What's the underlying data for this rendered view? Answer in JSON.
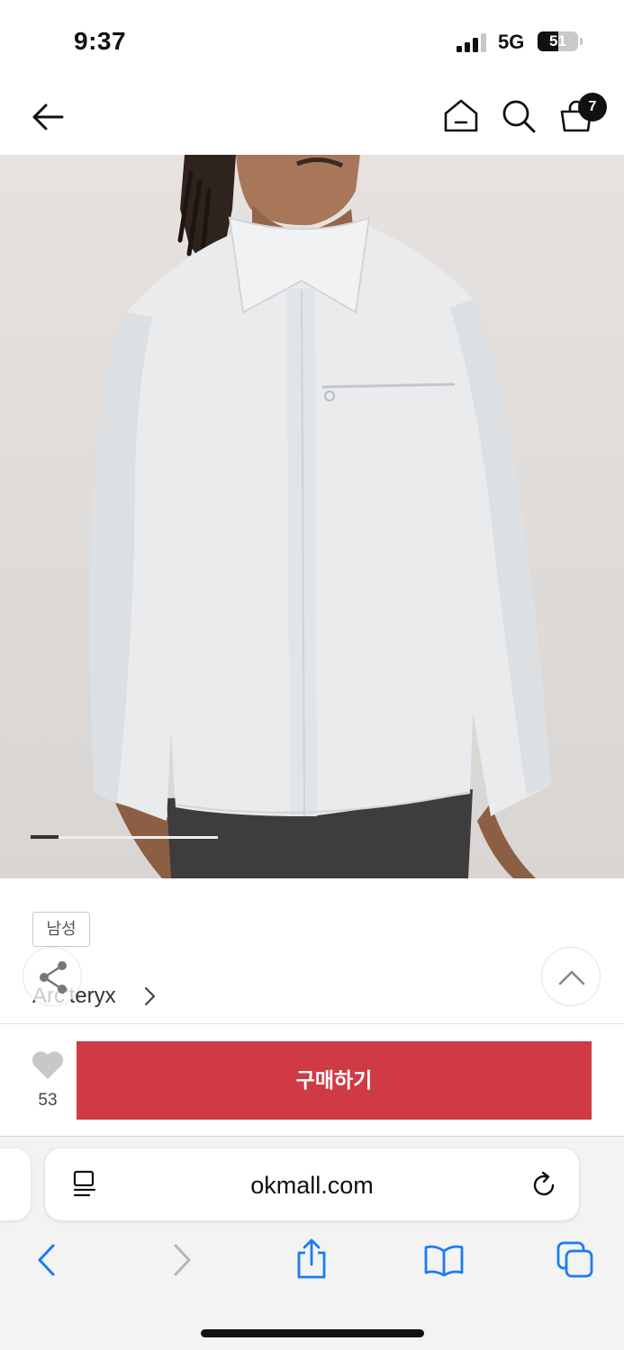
{
  "status_bar": {
    "time": "9:37",
    "network": "5G",
    "battery": "51"
  },
  "header": {
    "cart_count": "7"
  },
  "product": {
    "gender_tag": "남성",
    "brand": "Arc'teryx",
    "image_count_indicator": {
      "active_index": 1
    }
  },
  "purchase_bar": {
    "like_count": "53",
    "buy_label": "구매하기"
  },
  "browser": {
    "url": "okmall.com"
  },
  "colors": {
    "buy_button": "#cf3a44",
    "ios_blue": "#1a7cf0"
  }
}
